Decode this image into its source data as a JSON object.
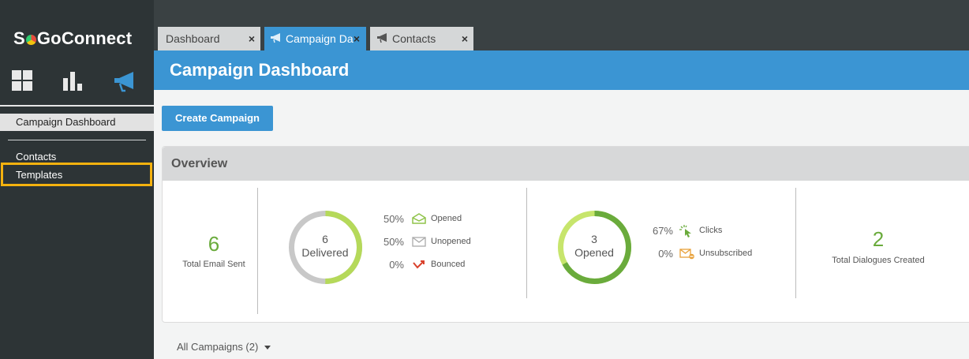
{
  "app": {
    "logo_prefix": "S",
    "logo_suffix": "GoConnect"
  },
  "sidebar": {
    "nav_icons": [
      "dashboard-grid-icon",
      "bar-chart-icon",
      "megaphone-icon"
    ],
    "items": [
      {
        "label": "Campaign Dashboard",
        "active": true
      },
      {
        "label": "Contacts",
        "active": false
      },
      {
        "label": "Templates",
        "active": false,
        "highlighted": true
      }
    ]
  },
  "tabs": [
    {
      "label": "Dashboard",
      "close": "×",
      "active": false
    },
    {
      "label": "Campaign Da",
      "close": "×",
      "active": true,
      "icon": "megaphone-icon"
    },
    {
      "label": "Contacts",
      "close": "×",
      "active": false,
      "icon": "megaphone-icon"
    }
  ],
  "header": {
    "title": "Campaign Dashboard"
  },
  "toolbar": {
    "create_label": "Create Campaign"
  },
  "overview": {
    "title": "Overview",
    "total_sent": {
      "value": "6",
      "label": "Total Email Sent"
    },
    "delivered": {
      "value": "6",
      "label": "Delivered",
      "fraction": 0.5,
      "stats": [
        {
          "pct": "50%",
          "label": "Opened",
          "icon": "open-envelope-icon"
        },
        {
          "pct": "50%",
          "label": "Unopened",
          "icon": "closed-envelope-icon"
        },
        {
          "pct": "0%",
          "label": "Bounced",
          "icon": "bounce-arrow-icon"
        }
      ]
    },
    "opened": {
      "value": "3",
      "label": "Opened",
      "fraction": 0.67,
      "stats": [
        {
          "pct": "67%",
          "label": "Clicks",
          "icon": "click-cursor-icon"
        },
        {
          "pct": "0%",
          "label": "Unsubscribed",
          "icon": "unsubscribe-envelope-icon"
        }
      ]
    },
    "dialogues": {
      "value": "2",
      "label": "Total Dialogues Created"
    }
  },
  "campaigns_filter": {
    "label": "All Campaigns (2)"
  },
  "colors": {
    "accent": "#3b95d3",
    "green": "#6aab3c",
    "light_green": "#b5d95a",
    "highlight": "#f5b20e"
  }
}
